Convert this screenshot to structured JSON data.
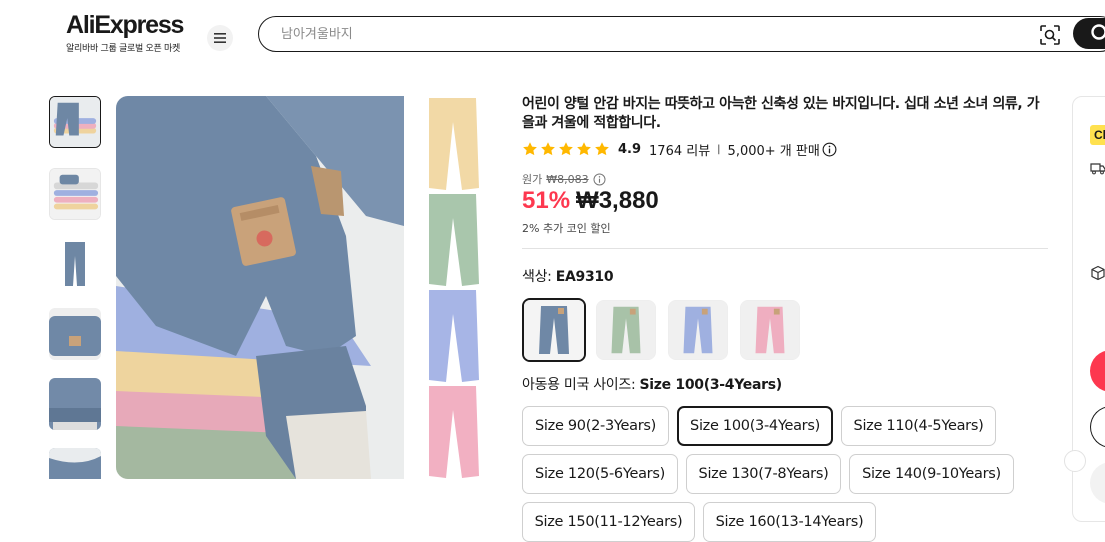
{
  "header": {
    "logo_text": "AliExpress",
    "logo_sub": "알리바바 그룹 글로벌 오픈 마켓",
    "search_placeholder": "남아겨울바지"
  },
  "product": {
    "title": "어린이 양털 안감 바지는 따뜻하고 아늑한 신축성 있는 바지입니다. 십대 소년 소녀 의류, 가을과 겨울에 적합합니다.",
    "rating": "4.9",
    "reviews": "1764 리뷰",
    "rating_sep": "|",
    "sold": "5,000+ 개 판매",
    "original_label": "원가",
    "original_price": "₩8,083",
    "discount": "51%",
    "price": "₩3,880",
    "coin_discount": "2% 추가 코인 할인",
    "color_label": "색상: ",
    "color_value": "EA9310",
    "size_label": "아동용 미국 사이즈: ",
    "size_value": "Size 100(3-4Years)",
    "sizes": [
      "Size 90(2-3Years)",
      "Size 100(3-4Years)",
      "Size 110(4-5Years)",
      "Size 120(5-6Years)",
      "Size 130(7-8Years)",
      "Size 140(9-10Years)",
      "Size 150(11-12Years)",
      "Size 160(13-14Years)"
    ],
    "selected_size_index": 1,
    "swatch_colors": [
      "#6f88a6",
      "#a8c2a8",
      "#9fb0e0",
      "#efaec0"
    ],
    "selected_swatch_index": 0
  },
  "right_panel": {
    "tag": "Ch"
  },
  "colors": {
    "accent_red": "#fd384f",
    "star": "#ffb800",
    "text": "#191919"
  }
}
